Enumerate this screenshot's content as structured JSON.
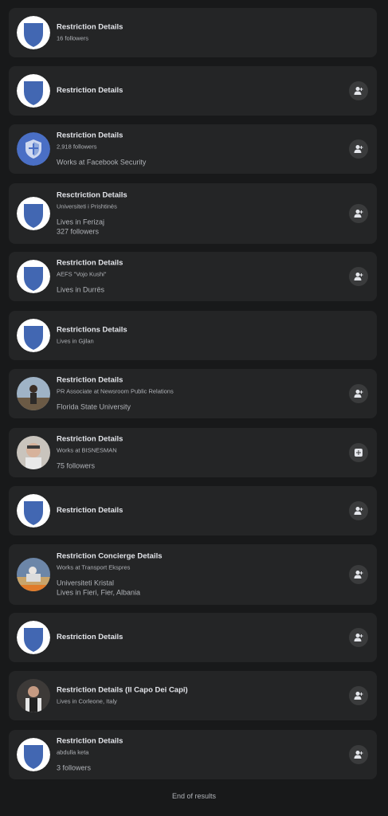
{
  "results": [
    {
      "name": "Restriction Details",
      "sub": "16 followers",
      "meta": [],
      "avatar": "shield-icon",
      "action": "none"
    },
    {
      "name": "Restriction Details",
      "sub": "",
      "meta": [],
      "avatar": "shield-icon",
      "action": "add-friend-icon"
    },
    {
      "name": "Restriction Details",
      "sub": "2,918 followers",
      "meta": [
        "Works at Facebook Security"
      ],
      "avatar": "security-shield-icon",
      "action": "add-friend-icon"
    },
    {
      "name": "Resctriction Details",
      "sub": "Universiteti i Prishtinës",
      "meta": [
        "Lives in Ferizaj",
        "327 followers"
      ],
      "avatar": "shield-icon",
      "action": "add-friend-icon"
    },
    {
      "name": "Restriction Details",
      "sub": "AEFS \"Vojo Kushi\"",
      "meta": [
        "Lives in Durrës"
      ],
      "avatar": "shield-icon",
      "action": "add-friend-icon"
    },
    {
      "name": "Restrictions Details",
      "sub": "Lives in Gjilan",
      "meta": [],
      "avatar": "shield-icon",
      "action": "none"
    },
    {
      "name": "Restriction Details",
      "sub": "PR Associate at Newsroom Public Relations",
      "meta": [
        "Florida State University"
      ],
      "avatar": "profile-photo",
      "action": "add-friend-icon"
    },
    {
      "name": "Restriction Details",
      "sub": "Works at BISNESMAN",
      "meta": [
        "75 followers"
      ],
      "avatar": "profile-photo",
      "action": "follow-icon"
    },
    {
      "name": "Restriction Details",
      "sub": "",
      "meta": [],
      "avatar": "shield-icon",
      "action": "add-friend-icon"
    },
    {
      "name": "Restriction Concierge Details",
      "sub": "Works at Transport Ekspres",
      "meta": [
        "Universiteti Kristal",
        "Lives in Fieri, Fier, Albania"
      ],
      "avatar": "profile-photo",
      "action": "add-friend-icon"
    },
    {
      "name": "Restriction Details",
      "sub": "",
      "meta": [],
      "avatar": "shield-icon",
      "action": "add-friend-icon"
    },
    {
      "name": "Restriction Details (Il Capo Dei Capi)",
      "sub": "Lives in Corleone, Italy",
      "meta": [],
      "avatar": "profile-photo",
      "action": "add-friend-icon"
    },
    {
      "name": "Restriction Details",
      "sub": "abdulla keta",
      "meta": [
        "3 followers"
      ],
      "avatar": "shield-icon",
      "action": "add-friend-icon"
    }
  ],
  "footer": {
    "end_text": "End of results"
  },
  "colors": {
    "background": "#18191a",
    "card": "#242526",
    "shield": "#4267b2",
    "button": "#3a3b3c"
  }
}
